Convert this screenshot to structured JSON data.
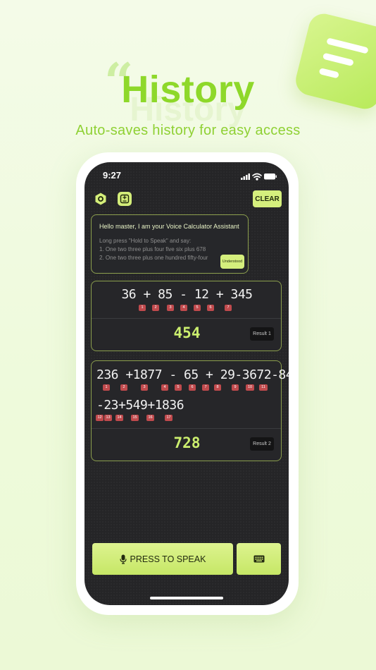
{
  "hero": {
    "quote_mark": "“",
    "title": "History",
    "title_echo": "History",
    "subtitle": "Auto-saves history for easy access"
  },
  "status_bar": {
    "time": "9:27"
  },
  "toolbar": {
    "clear_label": "CLEAR"
  },
  "assistant": {
    "greeting": "Hello master, I am your Voice Calculator Assistant",
    "lines": [
      "Long press \"Hold to Speak\" and say:",
      "1. One two three plus four five six plus 678",
      "2. One two three plus one hundred fifty-four"
    ],
    "understood_label": "Understood"
  },
  "history": [
    {
      "expression_lines": [
        "36 + 85 - 12 + 345"
      ],
      "badges": [
        "1",
        "2",
        "3",
        "4",
        "5",
        "6",
        "7"
      ],
      "result": "454",
      "result_label": "Result 1"
    },
    {
      "expression_lines": [
        "236 +1877 - 65 + 29-3672-84",
        "-23+549+1836"
      ],
      "badges": [
        "1",
        "2",
        "3",
        "4",
        "5",
        "6",
        "7",
        "8",
        "9",
        "10",
        "11",
        "12",
        "13",
        "14",
        "15",
        "16",
        "17"
      ],
      "result": "728",
      "result_label": "Result 2"
    }
  ],
  "bottom_bar": {
    "speak_label": "PRESS TO SPEAK"
  },
  "colors": {
    "accent": "#c9ea6a",
    "hero_green": "#8ed82a",
    "screen_bg": "#252527",
    "badge_red": "#c04a4d",
    "result_green": "#cbee6e"
  },
  "icons": [
    "menu-lines-icon",
    "settings-hexagon-icon",
    "calculator-icon",
    "signal-icon",
    "wifi-icon",
    "battery-icon",
    "microphone-icon",
    "keyboard-icon"
  ]
}
